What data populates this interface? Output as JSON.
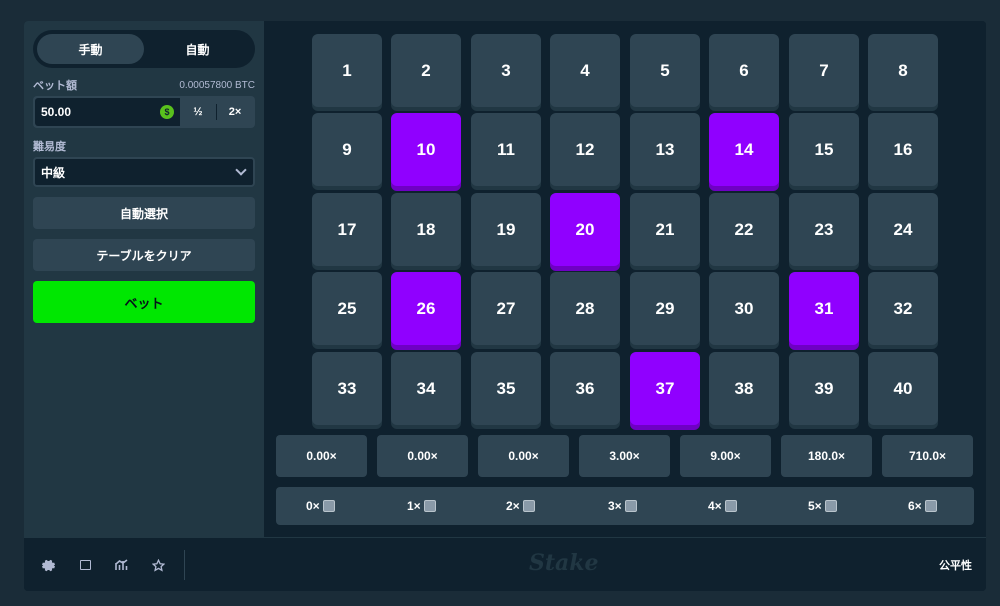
{
  "sidebar": {
    "mode_tabs": [
      "手動",
      "自動"
    ],
    "bet_amount_label": "ベット額",
    "bet_amount_btc": "0.00057800 BTC",
    "bet_value": "50.00",
    "currency_icon": "$",
    "half_label": "½",
    "double_label": "2×",
    "difficulty_label": "難易度",
    "difficulty_value": "中級",
    "auto_pick_label": "自動選択",
    "clear_table_label": "テーブルをクリア",
    "bet_button_label": "ベット"
  },
  "grid": {
    "tiles": [
      "1",
      "2",
      "3",
      "4",
      "5",
      "6",
      "7",
      "8",
      "9",
      "10",
      "11",
      "12",
      "13",
      "14",
      "15",
      "16",
      "17",
      "18",
      "19",
      "20",
      "21",
      "22",
      "23",
      "24",
      "25",
      "26",
      "27",
      "28",
      "29",
      "30",
      "31",
      "32",
      "33",
      "34",
      "35",
      "36",
      "37",
      "38",
      "39",
      "40"
    ],
    "selected": [
      "10",
      "14",
      "20",
      "26",
      "31",
      "37"
    ]
  },
  "payouts": [
    "0.00×",
    "0.00×",
    "0.00×",
    "3.00×",
    "9.00×",
    "180.0×",
    "710.0×"
  ],
  "hits": [
    "0×",
    "1×",
    "2×",
    "3×",
    "4×",
    "5×",
    "6×"
  ],
  "footer": {
    "logo": "Stake",
    "fairness_label": "公平性",
    "icons": [
      "gear-icon",
      "theatre-icon",
      "stats-icon",
      "star-icon"
    ]
  },
  "colors": {
    "accent_selected": "#9000ff",
    "bet_button": "#00e701",
    "tile": "#2f4553",
    "panel": "#213743",
    "background": "#0f212e"
  }
}
